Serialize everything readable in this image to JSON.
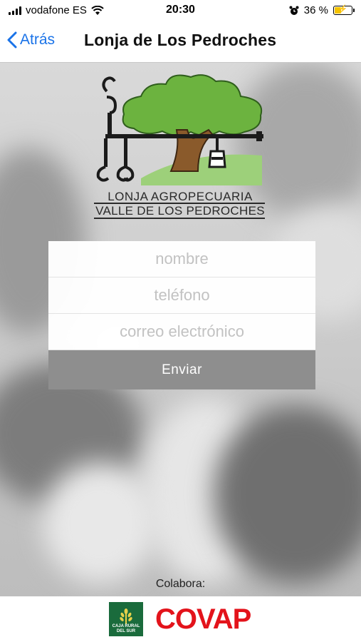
{
  "status_bar": {
    "carrier": "vodafone ES",
    "time": "20:30",
    "battery_percent": "36 %",
    "icons": [
      "signal-icon",
      "wifi-icon",
      "alarm-icon",
      "battery-charging-icon"
    ]
  },
  "nav": {
    "back_label": "Atrás",
    "title": "Lonja de Los Pedroches"
  },
  "logo": {
    "line1": "LONJA AGROPECUARIA",
    "line2": "VALLE DE LOS PEDROCHES"
  },
  "form": {
    "name_placeholder": "nombre",
    "phone_placeholder": "teléfono",
    "email_placeholder": "correo electrónico",
    "submit_label": "Enviar"
  },
  "footer": {
    "collab_label": "Colabora:",
    "sponsor1_text": "CAJA RURAL DEL SUR",
    "sponsor2_text": "COVAP"
  },
  "colors": {
    "accent": "#1a73e8",
    "submit_bg": "#8e8e8e",
    "covap_red": "#e3131b",
    "caja_rural_green": "#1a6b3c",
    "logo_tree_green": "#6cb33f"
  }
}
